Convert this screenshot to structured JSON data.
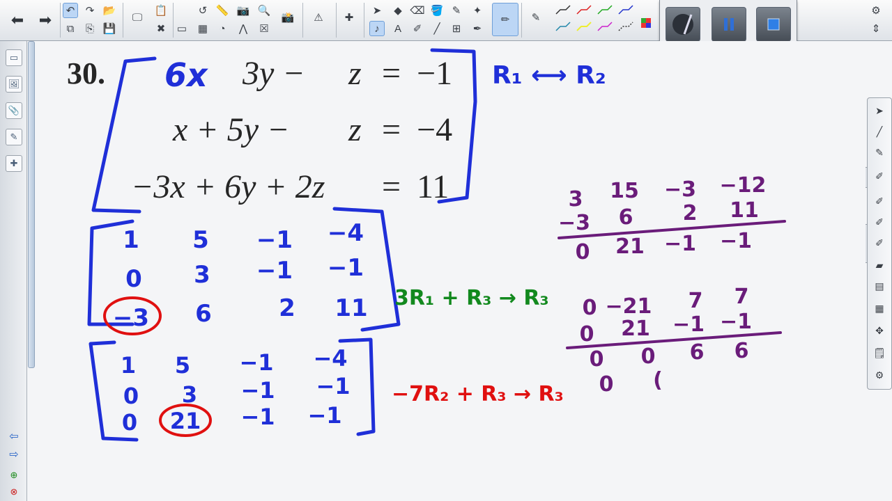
{
  "problem": {
    "number": "30.",
    "equations": [
      {
        "a": "6x",
        "b": "3y −",
        "c": "z",
        "eq": "=",
        "rhs": "−1"
      },
      {
        "a": "x + 5y −",
        "b": "",
        "c": "z",
        "eq": "=",
        "rhs": "−4"
      },
      {
        "a": "−3x + 6y + 2z",
        "b": "",
        "c": "",
        "eq": "=",
        "rhs": "11"
      }
    ]
  },
  "annotations": {
    "swap": "R₁ ⟷ R₂",
    "op1": "3R₁ + R₃ → R₃",
    "op2": "−7R₂ + R₃ → R₃"
  },
  "matrix1": {
    "rows": [
      [
        "1",
        "5",
        "−1",
        "−4"
      ],
      [
        "0",
        "3",
        "−1",
        "−1"
      ],
      [
        "−3",
        "6",
        "2",
        "11"
      ]
    ]
  },
  "matrix2": {
    "rows": [
      [
        "1",
        "5",
        "−1",
        "−4"
      ],
      [
        "0",
        "3",
        "−1",
        "−1"
      ],
      [
        "0",
        "21",
        "−1",
        "−1"
      ]
    ]
  },
  "work1": {
    "row_a": [
      "3",
      "15",
      "−3",
      "−12"
    ],
    "row_b": [
      "−3",
      "6",
      "2",
      "11"
    ],
    "sum": [
      "0",
      "21",
      "−1",
      "−1"
    ]
  },
  "work2": {
    "row_a": [
      "0",
      "−21",
      "7",
      "7"
    ],
    "row_b": [
      "0",
      "21",
      "−1",
      "−1"
    ],
    "sum": [
      "0",
      "0",
      "6",
      "6"
    ],
    "partial": [
      "0",
      "("
    ]
  },
  "colors": {
    "blue_ink": "#1f2fd8",
    "red_ink": "#e01010",
    "green_ink": "#12891e",
    "purple_ink": "#6a1c7a",
    "typeset": "#262626"
  },
  "icons": {
    "back": "arrow-left-icon",
    "forward": "arrow-right-icon",
    "undo": "undo-icon",
    "redo": "redo-icon",
    "settings": "gear-icon"
  }
}
